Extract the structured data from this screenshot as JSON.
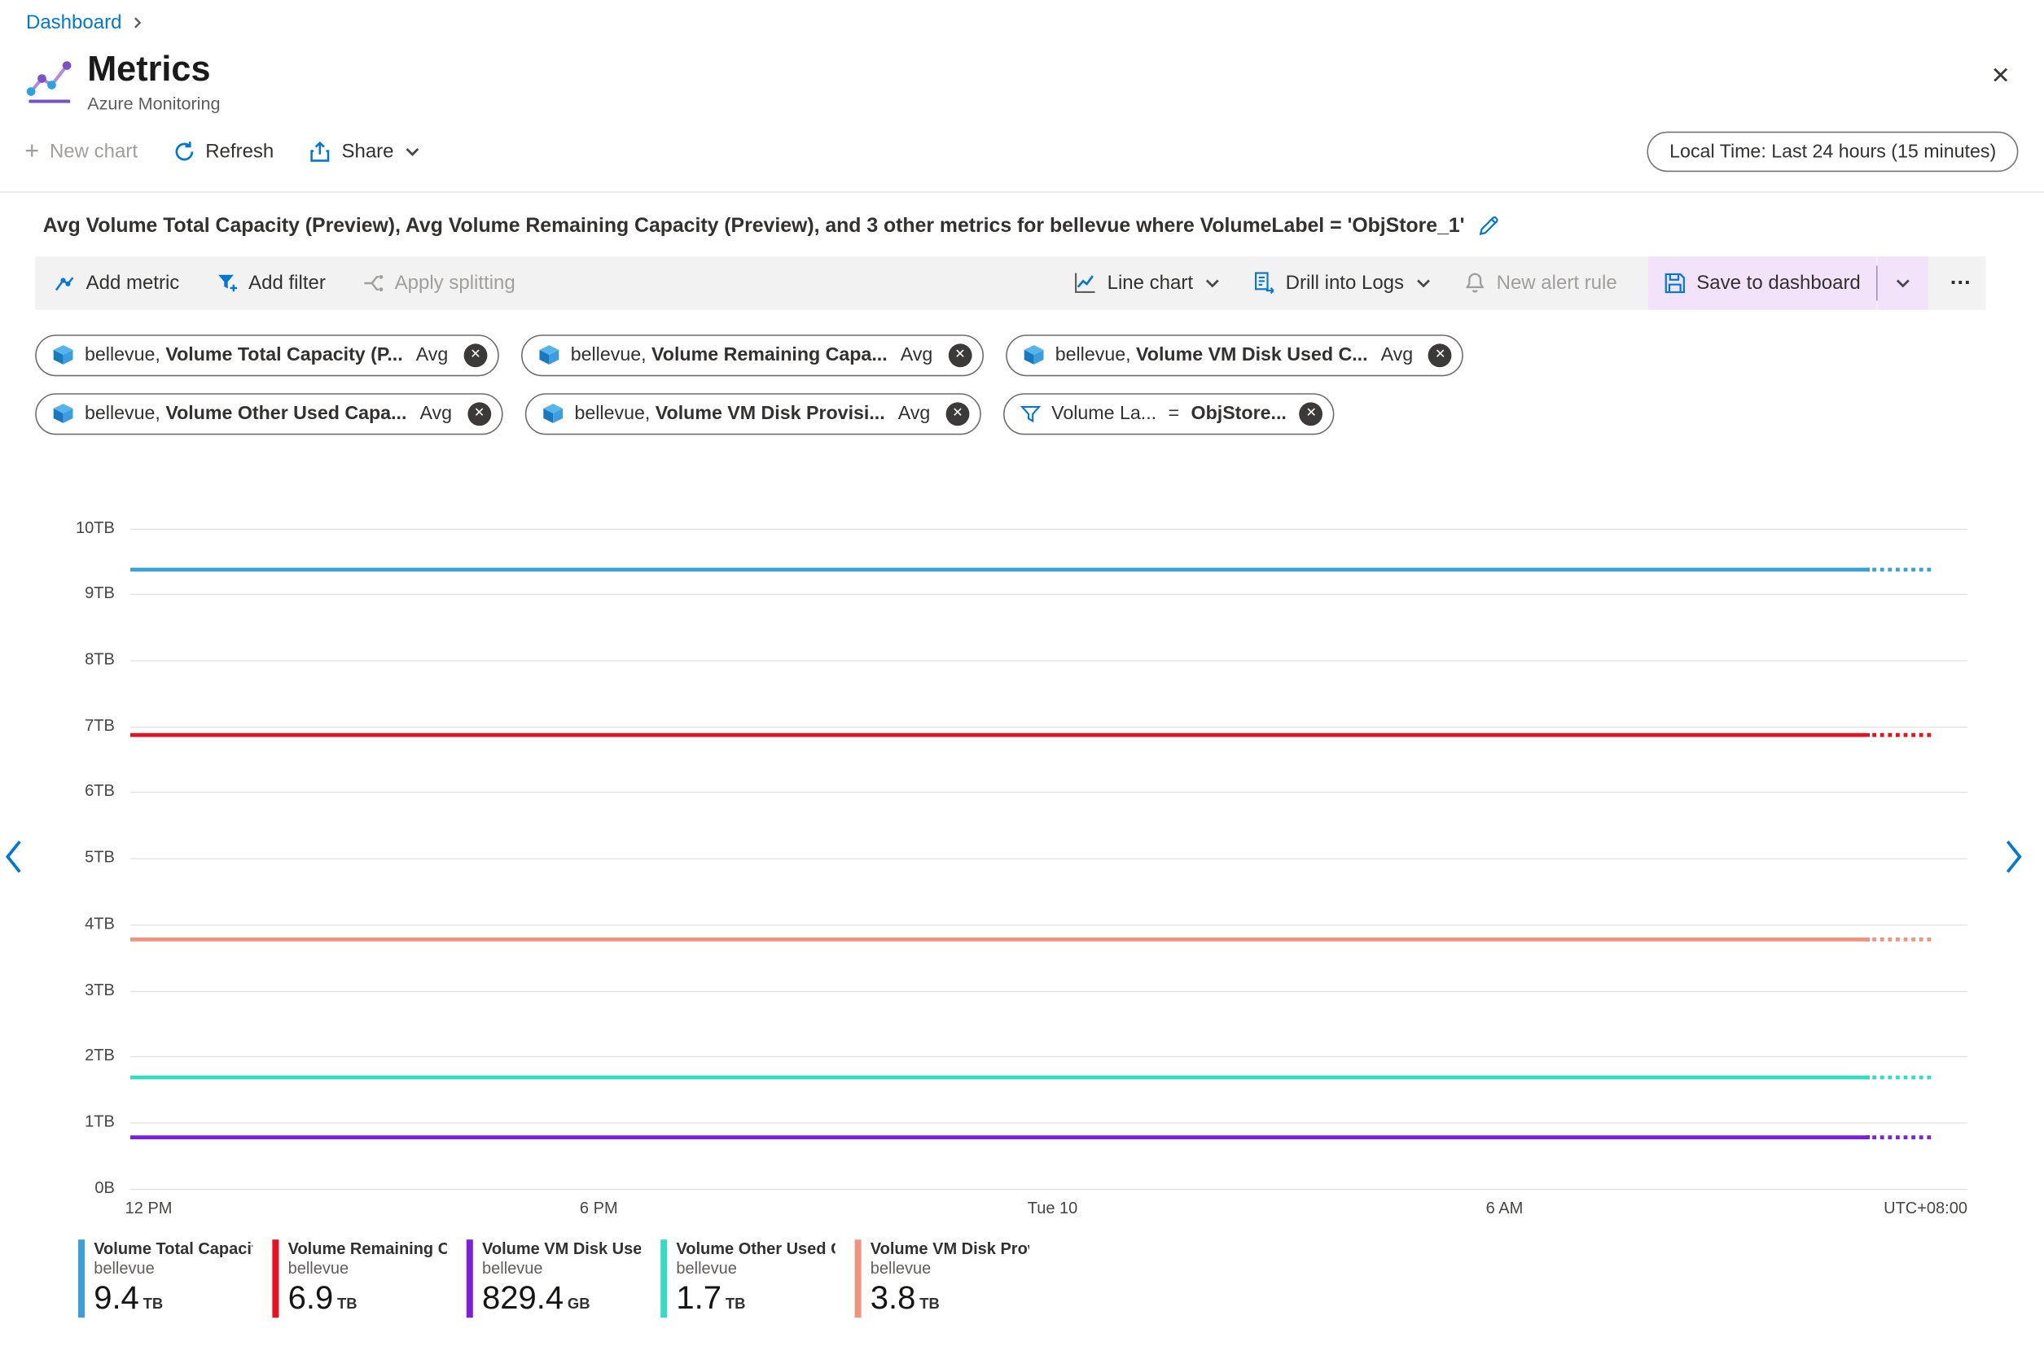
{
  "colors": {
    "accent": "#0078d4",
    "save_highlight": "#f2e3fa",
    "toolbar_bg": "#f2f2f2",
    "text": "#323130",
    "text_secondary": "#605e5c",
    "disabled": "#a19f9d"
  },
  "icons": {
    "close": "✕",
    "plus": "+",
    "remove": "✕"
  },
  "breadcrumb": {
    "dashboard": "Dashboard"
  },
  "header": {
    "title": "Metrics",
    "subtitle": "Azure Monitoring"
  },
  "commandbar": {
    "new_chart": "New chart",
    "refresh": "Refresh",
    "share": "Share",
    "time_range": "Local Time: Last 24 hours (15 minutes)"
  },
  "chart_header": {
    "title": "Avg Volume Total Capacity (Preview), Avg Volume Remaining Capacity (Preview), and 3 other metrics for bellevue where VolumeLabel = 'ObjStore_1'"
  },
  "toolbar": {
    "add_metric": "Add metric",
    "add_filter": "Add filter",
    "apply_splitting": "Apply splitting",
    "line_chart": "Line chart",
    "drill_into_logs": "Drill into Logs",
    "new_alert_rule": "New alert rule",
    "save_to_dashboard": "Save to dashboard",
    "more": "…"
  },
  "pills": {
    "metrics": [
      {
        "scope": "bellevue,",
        "metric": "Volume Total Capacity (P...",
        "agg": "Avg"
      },
      {
        "scope": "bellevue,",
        "metric": "Volume Remaining Capa...",
        "agg": "Avg"
      },
      {
        "scope": "bellevue,",
        "metric": "Volume VM Disk Used C...",
        "agg": "Avg"
      },
      {
        "scope": "bellevue,",
        "metric": "Volume Other Used Capa...",
        "agg": "Avg"
      },
      {
        "scope": "bellevue,",
        "metric": "Volume VM Disk Provisi...",
        "agg": "Avg"
      }
    ],
    "filter": {
      "field": "Volume La...",
      "op": "=",
      "value": "ObjStore..."
    }
  },
  "chart_data": {
    "type": "line",
    "title": "Avg Volume Total Capacity (Preview), Avg Volume Remaining Capacity (Preview), and 3 other metrics for bellevue where VolumeLabel = 'ObjStore_1'",
    "grid": true,
    "legend_position": "bottom",
    "ylim_tb": [
      0,
      10
    ],
    "y_unit": "TB",
    "y_ticks": [
      "0B",
      "1TB",
      "2TB",
      "3TB",
      "4TB",
      "5TB",
      "6TB",
      "7TB",
      "8TB",
      "9TB",
      "10TB"
    ],
    "x_ticks": [
      {
        "label": "12 PM",
        "pos": 0.01
      },
      {
        "label": "6 PM",
        "pos": 0.255
      },
      {
        "label": "Tue 10",
        "pos": 0.502
      },
      {
        "label": "6 AM",
        "pos": 0.748
      }
    ],
    "x_right_label": "UTC+08:00",
    "solid_fraction": 0.945,
    "dotted_fraction": 0.035,
    "series": [
      {
        "name": "Volume Total Capacit...",
        "resource": "bellevue",
        "value_tb": 9.4,
        "display_value": "9.4",
        "unit": "TB",
        "color": "#3b9fd9"
      },
      {
        "name": "Volume Remaining Cap...",
        "resource": "bellevue",
        "value_tb": 6.9,
        "display_value": "6.9",
        "unit": "TB",
        "color": "#e81123"
      },
      {
        "name": "Volume VM Disk Used ...",
        "resource": "bellevue",
        "value_tb": 0.81,
        "display_value": "829.4",
        "unit": "GB",
        "color": "#7d1fe0"
      },
      {
        "name": "Volume Other Used Ca...",
        "resource": "bellevue",
        "value_tb": 1.7,
        "display_value": "1.7",
        "unit": "TB",
        "color": "#34dcc3"
      },
      {
        "name": "Volume VM Disk Provi...",
        "resource": "bellevue",
        "value_tb": 3.8,
        "display_value": "3.8",
        "unit": "TB",
        "color": "#f1947f"
      }
    ]
  },
  "legend": [
    {
      "title": "Volume Total Capacit...",
      "resource": "bellevue",
      "value": "9.4",
      "unit": "TB",
      "color": "#3b9fd9"
    },
    {
      "title": "Volume Remaining Cap...",
      "resource": "bellevue",
      "value": "6.9",
      "unit": "TB",
      "color": "#e81123"
    },
    {
      "title": "Volume VM Disk Used ...",
      "resource": "bellevue",
      "value": "829.4",
      "unit": "GB",
      "color": "#7d1fe0"
    },
    {
      "title": "Volume Other Used Ca...",
      "resource": "bellevue",
      "value": "1.7",
      "unit": "TB",
      "color": "#34dcc3"
    },
    {
      "title": "Volume VM Disk Provi...",
      "resource": "bellevue",
      "value": "3.8",
      "unit": "TB",
      "color": "#f1947f"
    }
  ]
}
